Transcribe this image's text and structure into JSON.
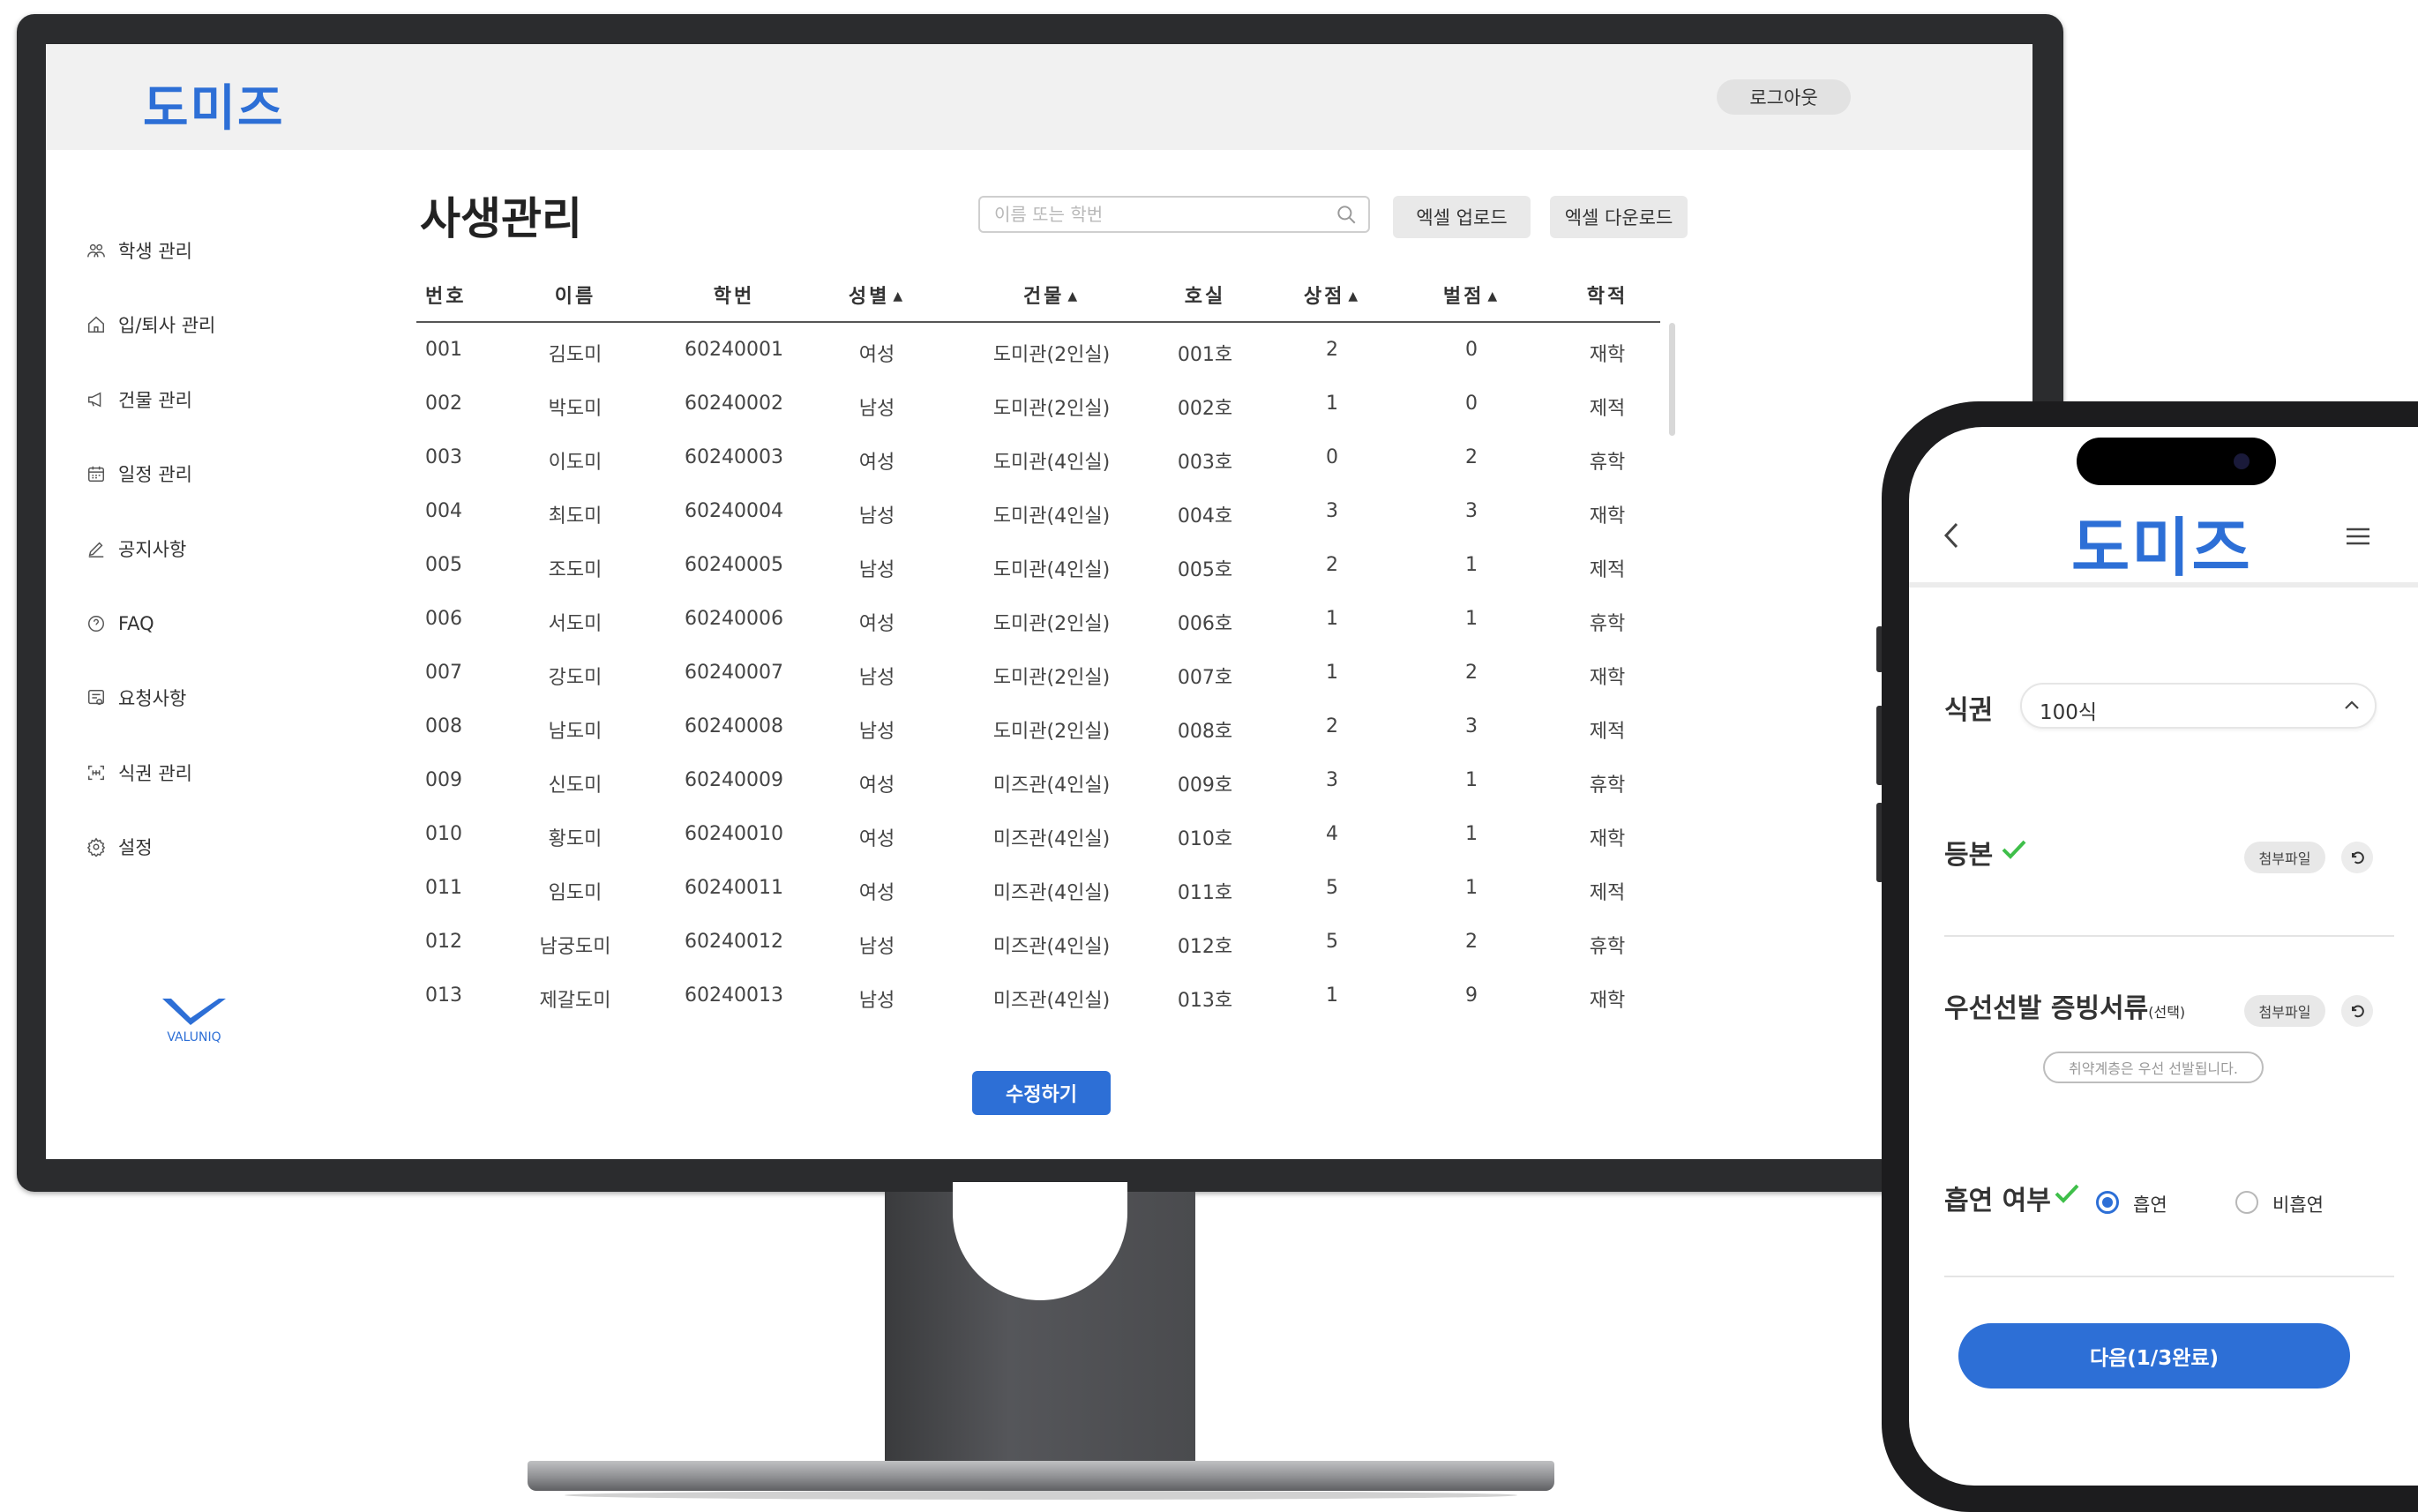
{
  "web": {
    "logo": "도미즈",
    "logout_label": "로그아웃",
    "sidebar": {
      "items": [
        {
          "label": "학생 관리",
          "icon": "students-icon"
        },
        {
          "label": "입/퇴사 관리",
          "icon": "home-icon"
        },
        {
          "label": "건물 관리",
          "icon": "megaphone-icon"
        },
        {
          "label": "일정 관리",
          "icon": "calendar-icon"
        },
        {
          "label": "공지사항",
          "icon": "pencil-icon"
        },
        {
          "label": "FAQ",
          "icon": "question-icon"
        },
        {
          "label": "요청사항",
          "icon": "request-icon"
        },
        {
          "label": "식권 관리",
          "icon": "scan-icon"
        },
        {
          "label": "설정",
          "icon": "gear-icon"
        }
      ],
      "brand": "VALUNIQ"
    },
    "page_title": "사생관리",
    "search_placeholder": "이름 또는 학번",
    "excel_upload_label": "엑셀 업로드",
    "excel_download_label": "엑셀 다운로드",
    "table": {
      "headers": [
        "번호",
        "이름",
        "학번",
        "성별",
        "건물",
        "호실",
        "상점",
        "벌점",
        "학적"
      ],
      "sortable": [
        false,
        false,
        false,
        true,
        true,
        false,
        true,
        true,
        false
      ],
      "rows": [
        [
          "001",
          "김도미",
          "60240001",
          "여성",
          "도미관(2인실)",
          "001호",
          "2",
          "0",
          "재학"
        ],
        [
          "002",
          "박도미",
          "60240002",
          "남성",
          "도미관(2인실)",
          "002호",
          "1",
          "0",
          "제적"
        ],
        [
          "003",
          "이도미",
          "60240003",
          "여성",
          "도미관(4인실)",
          "003호",
          "0",
          "2",
          "휴학"
        ],
        [
          "004",
          "최도미",
          "60240004",
          "남성",
          "도미관(4인실)",
          "004호",
          "3",
          "3",
          "재학"
        ],
        [
          "005",
          "조도미",
          "60240005",
          "남성",
          "도미관(4인실)",
          "005호",
          "2",
          "1",
          "제적"
        ],
        [
          "006",
          "서도미",
          "60240006",
          "여성",
          "도미관(2인실)",
          "006호",
          "1",
          "1",
          "휴학"
        ],
        [
          "007",
          "강도미",
          "60240007",
          "남성",
          "도미관(2인실)",
          "007호",
          "1",
          "2",
          "재학"
        ],
        [
          "008",
          "남도미",
          "60240008",
          "남성",
          "도미관(2인실)",
          "008호",
          "2",
          "3",
          "제적"
        ],
        [
          "009",
          "신도미",
          "60240009",
          "여성",
          "미즈관(4인실)",
          "009호",
          "3",
          "1",
          "휴학"
        ],
        [
          "010",
          "황도미",
          "60240010",
          "여성",
          "미즈관(4인실)",
          "010호",
          "4",
          "1",
          "재학"
        ],
        [
          "011",
          "임도미",
          "60240011",
          "여성",
          "미즈관(4인실)",
          "011호",
          "5",
          "1",
          "제적"
        ],
        [
          "012",
          "남궁도미",
          "60240012",
          "남성",
          "미즈관(4인실)",
          "012호",
          "5",
          "2",
          "휴학"
        ],
        [
          "013",
          "제갈도미",
          "60240013",
          "남성",
          "미즈관(4인실)",
          "013호",
          "1",
          "9",
          "재학"
        ]
      ]
    },
    "edit_label": "수정하기"
  },
  "phone": {
    "logo": "도미즈",
    "meal_ticket": {
      "label": "식권",
      "value": "100식"
    },
    "certificate": {
      "label": "등본",
      "attach_label": "첨부파일"
    },
    "priority_docs": {
      "label": "우선선발 증빙서류",
      "tag": "(선택)",
      "attach_label": "첨부파일",
      "notice": "취약계층은 우선 선발됩니다."
    },
    "smoking": {
      "label": "흡연 여부",
      "option_smoker": "흡연",
      "option_nonsmoker": "비흡연",
      "selected": "흡연"
    },
    "next_label": "다음(1/3완료)"
  },
  "colors": {
    "accent": "#2d6fd6",
    "check": "#3fbf4a"
  }
}
